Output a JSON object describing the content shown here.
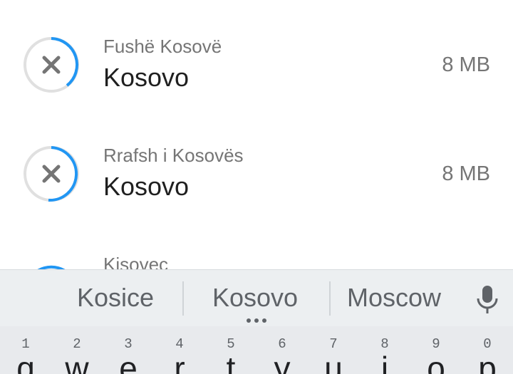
{
  "list": {
    "items": [
      {
        "subtitle": "Fushë Kosovë",
        "title": "Kosovo",
        "size": "8 MB",
        "icon": "cancel-download-icon"
      },
      {
        "subtitle": "Rrafsh i Kosovës",
        "title": "Kosovo",
        "size": "8 MB",
        "icon": "cancel-download-icon"
      },
      {
        "subtitle": "Kisovec",
        "icon": "cancel-download-icon"
      }
    ]
  },
  "keyboard": {
    "suggestions": [
      "Kosice",
      "Kosovo",
      "Moscow"
    ],
    "more_suggestions_icon": "more-dots-icon",
    "mic_icon": "microphone-icon",
    "keys": [
      {
        "hint": "1",
        "char": "q"
      },
      {
        "hint": "2",
        "char": "w"
      },
      {
        "hint": "3",
        "char": "e"
      },
      {
        "hint": "4",
        "char": "r"
      },
      {
        "hint": "5",
        "char": "t"
      },
      {
        "hint": "6",
        "char": "y"
      },
      {
        "hint": "7",
        "char": "u"
      },
      {
        "hint": "8",
        "char": "i"
      },
      {
        "hint": "9",
        "char": "o"
      },
      {
        "hint": "0",
        "char": "p"
      }
    ]
  },
  "colors": {
    "progress_accent": "#2196f3",
    "progress_track": "#e0e0e0",
    "cancel_icon": "#757575",
    "keyboard_bg": "#e8eaed",
    "suggestion_bg": "#eceff1"
  }
}
